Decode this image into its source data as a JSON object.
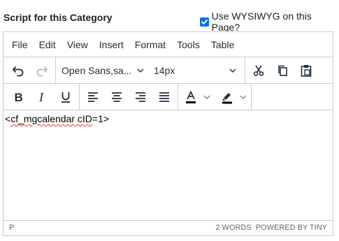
{
  "heading": "Script for this Category",
  "wysiwyg_checkbox": {
    "label": "Use WYSIWYG on this Page?",
    "checked": true
  },
  "menubar": [
    "File",
    "Edit",
    "View",
    "Insert",
    "Format",
    "Tools",
    "Table"
  ],
  "toolbar": {
    "font_family": "Open Sans,sa...",
    "font_size": "14px"
  },
  "content": {
    "prefix": "<",
    "misspelled": "cf_mgcalendar cID",
    "suffix": "=1>"
  },
  "statusbar": {
    "path": "P",
    "word_count": "2 WORDS",
    "branding": "POWERED BY TINY"
  },
  "colors": {
    "checkbox": "#0b6fe3",
    "text_color_bar": "#000000",
    "highlight_bar": "#000000",
    "icon": "#222f3e"
  }
}
